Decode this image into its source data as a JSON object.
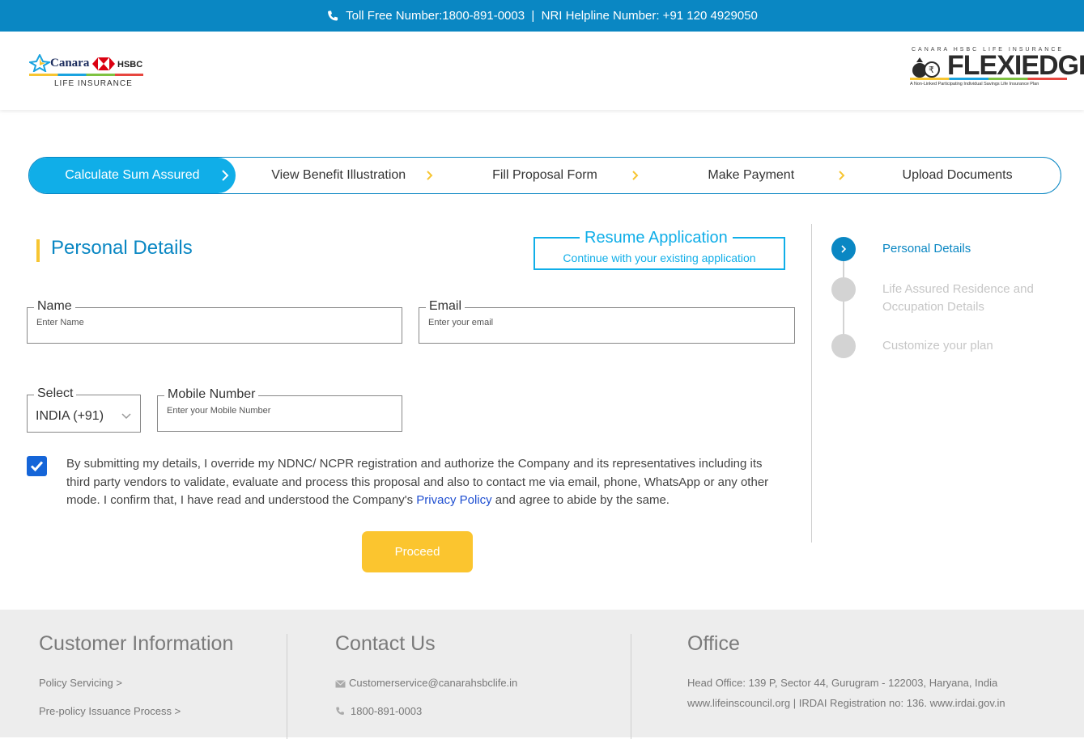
{
  "topbar": {
    "text": "Toll Free Number:1800-891-0003  |  NRI Helpline Number: +91 120 4929050"
  },
  "header": {
    "left_logo": {
      "canara": "Canara",
      "hsbc": "HSBC",
      "sub": "LIFE INSURANCE"
    },
    "right_logo": {
      "small": "CANARA HSBC LIFE INSURANCE",
      "brand": "FLEXIEDGE",
      "tagline": "A Non-Linked Participating Individual Savings Life Insurance Plan"
    }
  },
  "stepper": {
    "steps": [
      {
        "label": "Calculate Sum Assured",
        "active": true
      },
      {
        "label": "View Benefit Illustration",
        "active": false
      },
      {
        "label": "Fill Proposal Form",
        "active": false
      },
      {
        "label": "Make Payment",
        "active": false
      },
      {
        "label": "Upload Documents",
        "active": false
      }
    ]
  },
  "form": {
    "title": "Personal Details",
    "resume": {
      "title": "Resume Application",
      "subtitle": "Continue with your existing application"
    },
    "name": {
      "label": "Name",
      "placeholder": "Enter Name",
      "value": ""
    },
    "email": {
      "label": "Email",
      "placeholder": "Enter your email",
      "value": ""
    },
    "country": {
      "label": "Select",
      "value": "INDIA (+91)"
    },
    "mobile": {
      "label": "Mobile Number",
      "placeholder": "Enter your Mobile Number",
      "value": ""
    },
    "consent": {
      "checked": true,
      "text_before": "By submitting my details, I override my NDNC/ NCPR registration and authorize the Company and its representatives including its third party vendors to validate, evaluate and process this proposal and also to contact me via email, phone, WhatsApp or any other mode. I confirm that, I have read and understood the Company's ",
      "link": "Privacy Policy",
      "text_after": " and agree to abide by the same."
    },
    "proceed_label": "Proceed"
  },
  "sidebar": {
    "items": [
      {
        "label": "Personal Details",
        "active": true
      },
      {
        "label": "Life Assured Residence and Occupation Details",
        "active": false
      },
      {
        "label": "Customize your plan",
        "active": false
      }
    ]
  },
  "footer": {
    "customer": {
      "title": "Customer Information",
      "links": [
        "Policy Servicing >",
        "Pre-policy Issuance Process >"
      ]
    },
    "contact": {
      "title": "Contact Us",
      "email": "Customerservice@canarahsbclife.in",
      "phone": "1800-891-0003"
    },
    "office": {
      "title": "Office",
      "address": "Head Office: 139 P, Sector 44, Gurugram - 122003, Haryana, India",
      "links": "www.lifeinscouncil.org | IRDAI Registration no: 136. www.irdai.gov.in"
    }
  },
  "colors": {
    "primary": "#0a87c3",
    "accent_blue": "#10aee8",
    "yellow": "#fbc52f",
    "checkbox": "#1565d8"
  }
}
